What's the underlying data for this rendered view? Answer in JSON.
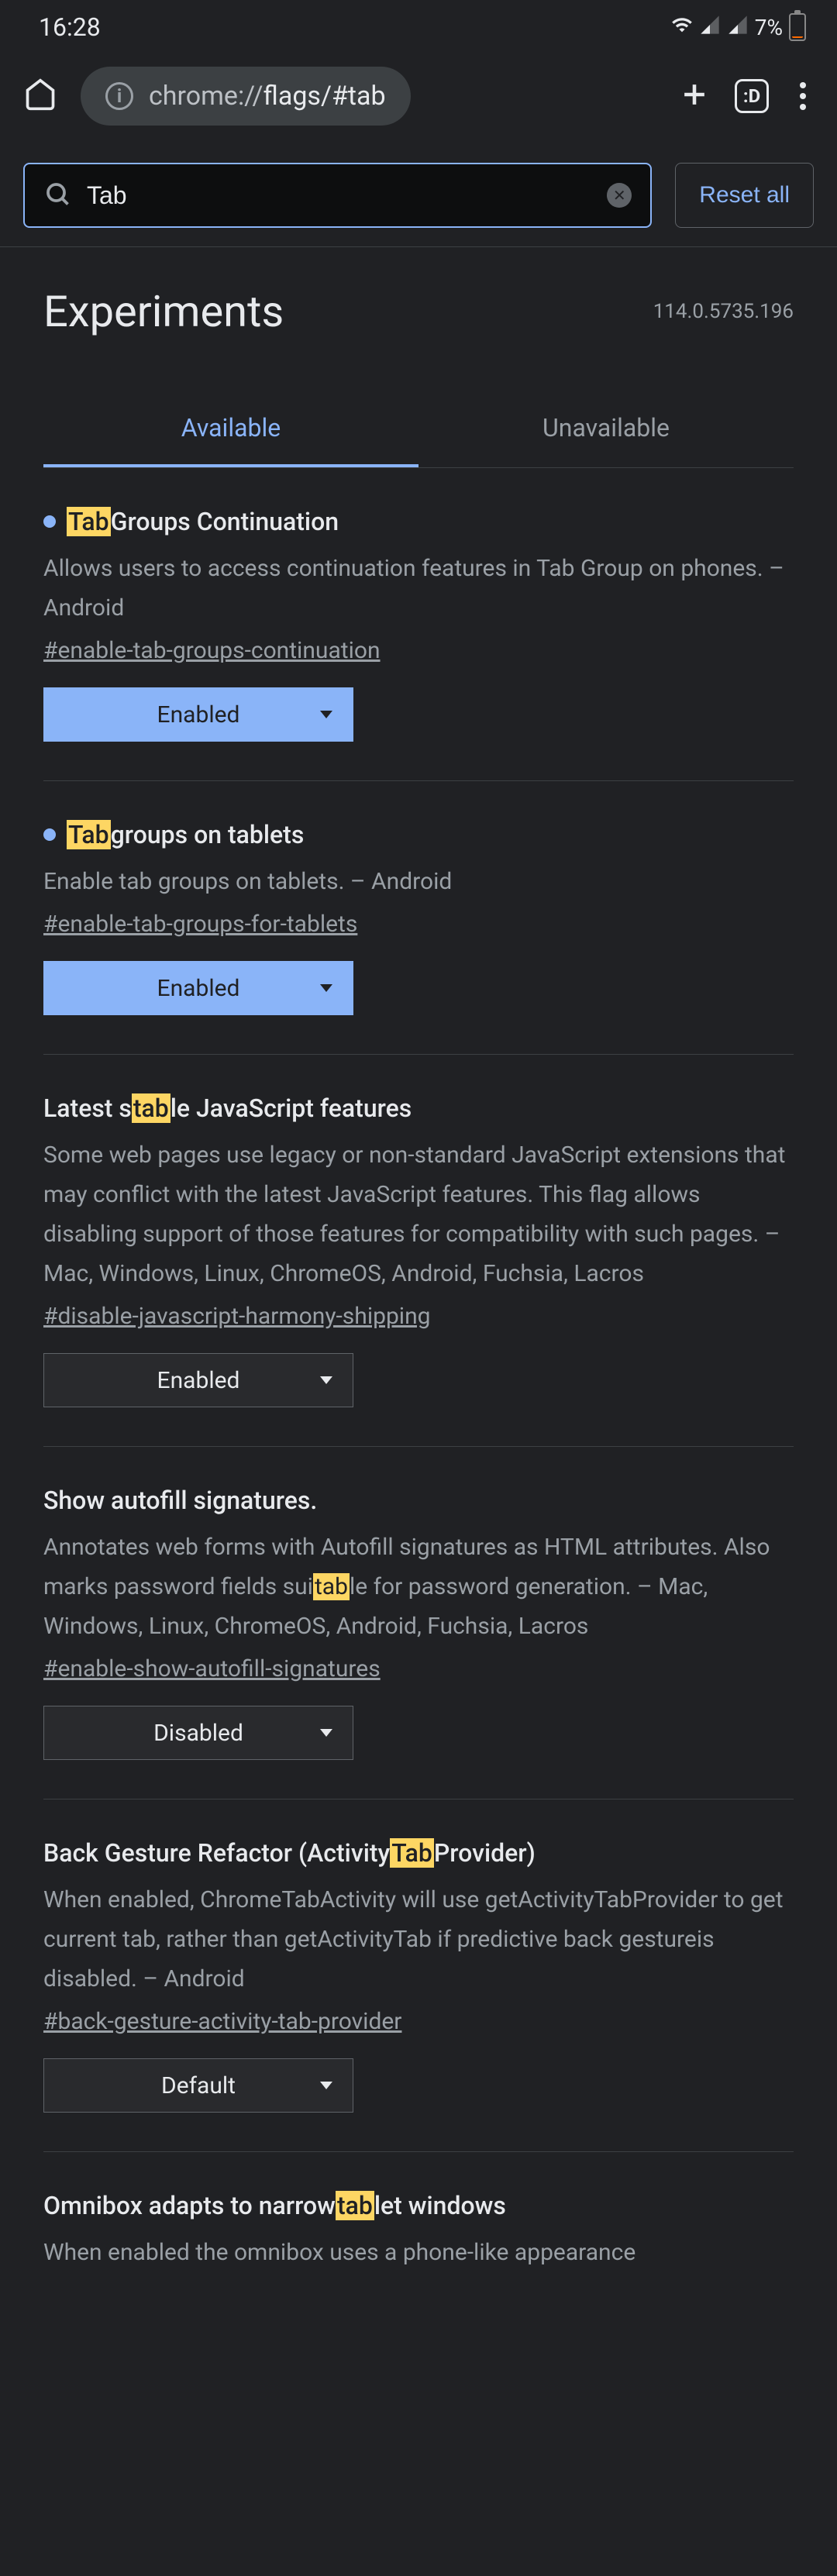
{
  "status": {
    "time": "16:28",
    "battery": "7%"
  },
  "browser": {
    "url_host": "chrome://",
    "url_path": "flags/#tab",
    "tab_count": ":D"
  },
  "search": {
    "value": "Tab",
    "reset_label": "Reset all"
  },
  "header": {
    "title": "Experiments",
    "version": "114.0.5735.196"
  },
  "tabs": {
    "available": "Available",
    "unavailable": "Unavailable"
  },
  "flags": [
    {
      "has_dot": true,
      "title_parts": [
        {
          "hl": true,
          "t": "Tab"
        },
        {
          "hl": false,
          "t": " Groups Continuation"
        }
      ],
      "desc_parts": [
        {
          "hl": false,
          "t": "Allows users to access continuation features in Tab Group on phones. – Android"
        }
      ],
      "hash": "#enable-tab-groups-continuation",
      "value": "Enabled",
      "style": "blue"
    },
    {
      "has_dot": true,
      "title_parts": [
        {
          "hl": true,
          "t": "Tab"
        },
        {
          "hl": false,
          "t": " groups on tablets"
        }
      ],
      "desc_parts": [
        {
          "hl": false,
          "t": "Enable tab groups on tablets. – Android"
        }
      ],
      "hash": "#enable-tab-groups-for-tablets",
      "value": "Enabled",
      "style": "blue"
    },
    {
      "has_dot": false,
      "title_parts": [
        {
          "hl": false,
          "t": "Latest s"
        },
        {
          "hl": true,
          "t": "tab"
        },
        {
          "hl": false,
          "t": "le JavaScript features"
        }
      ],
      "desc_parts": [
        {
          "hl": false,
          "t": "Some web pages use legacy or non-standard JavaScript extensions that may conflict with the latest JavaScript features. This flag allows disabling support of those features for compatibility with such pages. – Mac, Windows, Linux, ChromeOS, Android, Fuchsia, Lacros"
        }
      ],
      "hash": "#disable-javascript-harmony-shipping",
      "value": "Enabled",
      "style": "dark"
    },
    {
      "has_dot": false,
      "title_parts": [
        {
          "hl": false,
          "t": "Show autofill signatures."
        }
      ],
      "desc_parts": [
        {
          "hl": false,
          "t": "Annotates web forms with Autofill signatures as HTML attributes. Also marks password fields sui"
        },
        {
          "hl": true,
          "t": "tab"
        },
        {
          "hl": false,
          "t": "le for password generation. – Mac, Windows, Linux, ChromeOS, Android, Fuchsia, Lacros"
        }
      ],
      "hash": "#enable-show-autofill-signatures",
      "value": "Disabled",
      "style": "dark"
    },
    {
      "has_dot": false,
      "title_parts": [
        {
          "hl": false,
          "t": "Back Gesture Refactor (Activity "
        },
        {
          "hl": true,
          "t": "Tab"
        },
        {
          "hl": false,
          "t": " Provider)"
        }
      ],
      "desc_parts": [
        {
          "hl": false,
          "t": "When enabled, ChromeTabActivity will use getActivityTabProvider to get current tab, rather than getActivityTab if predictive back gestureis disabled. – Android"
        }
      ],
      "hash": "#back-gesture-activity-tab-provider",
      "value": "Default",
      "style": "dark"
    },
    {
      "has_dot": false,
      "title_parts": [
        {
          "hl": false,
          "t": "Omnibox adapts to narrow "
        },
        {
          "hl": true,
          "t": "tab"
        },
        {
          "hl": false,
          "t": "let windows"
        }
      ],
      "desc_parts": [
        {
          "hl": false,
          "t": "When enabled the omnibox uses a phone-like appearance"
        }
      ],
      "hash": "",
      "value": "",
      "style": "dark",
      "truncated": true
    }
  ]
}
